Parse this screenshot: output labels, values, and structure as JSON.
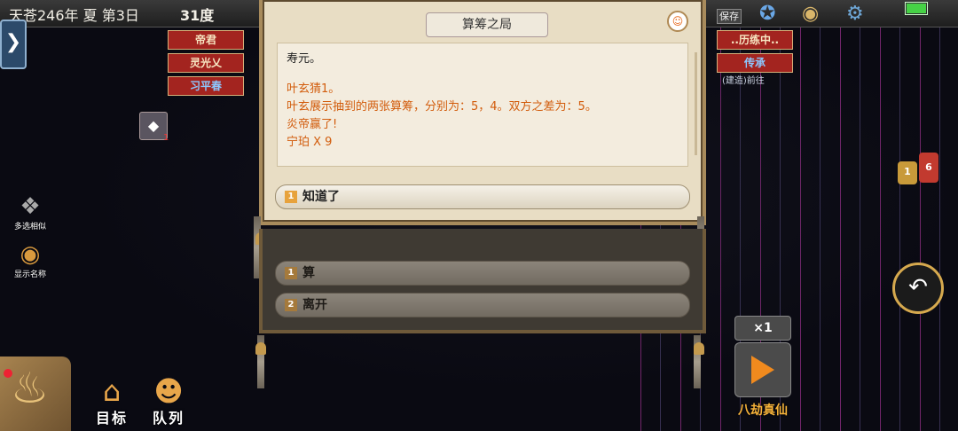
{
  "topbar": {
    "date": "天苍246年 夏 第3日",
    "temperature": "31度",
    "save_label": "保存"
  },
  "left_tab": {
    "label": "❯"
  },
  "npc_tags": [
    {
      "label": "帝君"
    },
    {
      "label": "灵光乂"
    },
    {
      "label": "习平春"
    }
  ],
  "right_tags": {
    "training": "..历练中..",
    "inherit": "传承",
    "link": "(建造)前往"
  },
  "left_actions": {
    "multi_select": "多选相似",
    "show_names": "显示名称"
  },
  "item_slot": {
    "count": "1"
  },
  "bottom_nav": {
    "goal": "目标",
    "queue": "队列"
  },
  "dialog": {
    "title": "算筹之局",
    "log_lines": [
      "寿元。",
      "",
      "叶玄猜1。",
      "叶玄展示抽到的两张算筹，分别为：5，4。双方之差为：5。",
      "炎帝赢了!",
      "宁珀 X 9"
    ],
    "confirm": {
      "num": "1",
      "label": "知道了"
    }
  },
  "panel2": {
    "options": [
      {
        "num": "1",
        "label": "算"
      },
      {
        "num": "2",
        "label": "离开"
      }
    ]
  },
  "chat": {
    "count_a": "1",
    "count_b": "6"
  },
  "speed": {
    "multiplier": "×1",
    "caption": "八劫真仙"
  },
  "colors": {
    "accent_orange": "#f08a1e",
    "log_text": "#d25c0c",
    "tag_red": "#a3241f",
    "dialog_bg": "#e8ddc4"
  },
  "icons": {
    "avatar": "person-icon",
    "settings": "gear-icon",
    "palette": "palette-icon",
    "map": "compass-icon",
    "back": "return-arrow-icon",
    "play": "play-icon"
  }
}
